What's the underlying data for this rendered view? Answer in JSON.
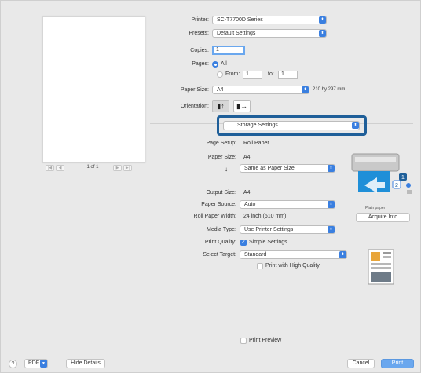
{
  "printer": {
    "label": "Printer:",
    "value": "SC-T7700D Series"
  },
  "presets": {
    "label": "Presets:",
    "value": "Default Settings"
  },
  "copies": {
    "label": "Copies:",
    "value": "1"
  },
  "pages": {
    "label": "Pages:",
    "all": "All",
    "from_label": "From:",
    "from_value": "1",
    "to_label": "to:",
    "to_value": "1"
  },
  "paper_size_top": {
    "label": "Paper Size:",
    "value": "A4",
    "dims": "210 by 297 mm"
  },
  "orientation": {
    "label": "Orientation:",
    "portrait_icon": "portrait-icon",
    "landscape_icon": "landscape-icon"
  },
  "section_popup": {
    "value": "Storage Settings"
  },
  "page_setup": {
    "label": "Page Setup:",
    "value": "Roll Paper"
  },
  "paper_size": {
    "label": "Paper Size:",
    "value": "A4"
  },
  "scale": {
    "arrow": "↓",
    "value": "Same as Paper Size"
  },
  "output_size": {
    "label": "Output Size:",
    "value": "A4"
  },
  "paper_source": {
    "label": "Paper Source:",
    "value": "Auto"
  },
  "roll_width": {
    "label": "Roll Paper Width:",
    "value": "24 inch (610 mm)"
  },
  "media_type": {
    "label": "Media Type:",
    "value": "Use Printer Settings"
  },
  "print_quality": {
    "label": "Print Quality:",
    "check": "Simple Settings"
  },
  "select_target": {
    "label": "Select Target:",
    "value": "Standard",
    "high_quality": "Print with High Quality"
  },
  "printer_panel": {
    "paper_label": "Plain paper",
    "acquire": "Acquire Info",
    "badge1": "1",
    "badge2": "2"
  },
  "preview": {
    "page_text": "1 of 1",
    "first": "|◀",
    "prev": "◀",
    "next": "▶",
    "last": "▶|"
  },
  "print_preview": "Print Preview",
  "footer": {
    "help": "?",
    "pdf": "PDF",
    "hide_details": "Hide Details",
    "cancel": "Cancel",
    "print": "Print"
  },
  "colors": {
    "accent": "#3a7fe0",
    "highlight": "#1f5f99"
  }
}
